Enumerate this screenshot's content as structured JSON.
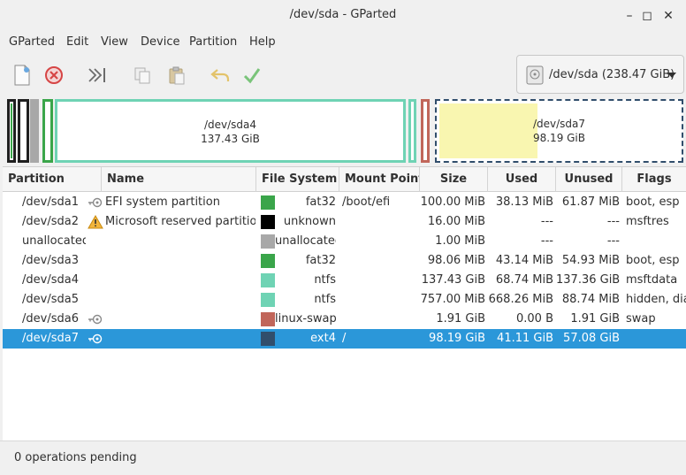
{
  "window": {
    "title": "/dev/sda - GParted"
  },
  "window_controls": {
    "minimize": "–",
    "maximize": "◻",
    "close": "✕"
  },
  "menu": [
    "GParted",
    "Edit",
    "View",
    "Device",
    "Partition",
    "Help"
  ],
  "toolbar": {
    "icons": [
      "new-icon",
      "delete-icon",
      "resize-move-icon",
      "copy-icon",
      "paste-icon",
      "undo-icon",
      "apply-icon"
    ]
  },
  "device_selector": {
    "label": "/dev/sda  (238.47 GiB)",
    "icon": "disk-icon"
  },
  "disk_map": {
    "segments": [
      {
        "name": "/dev/sda4",
        "size": "137.43 GiB",
        "color": "#6fd3b4"
      },
      {
        "name": "/dev/sda7",
        "size": "98.19 GiB",
        "color": "#f9f6b0",
        "selected": true
      }
    ]
  },
  "table": {
    "headers": [
      "Partition",
      "Name",
      "File System",
      "Mount Point",
      "Size",
      "Used",
      "Unused",
      "Flags"
    ],
    "rows": [
      {
        "partition": "/dev/sda1",
        "icon": "key-icon",
        "name": "EFI system partition",
        "fs": "fat32",
        "fs_color": "#3aa54a",
        "mount": "/boot/efi",
        "size": "100.00 MiB",
        "used": "38.13 MiB",
        "unused": "61.87 MiB",
        "flags": "boot, esp"
      },
      {
        "partition": "/dev/sda2",
        "icon": "warning-icon",
        "name": "Microsoft reserved partition",
        "fs": "unknown",
        "fs_color": "#000000",
        "mount": "",
        "size": "16.00 MiB",
        "used": "---",
        "unused": "---",
        "flags": "msftres"
      },
      {
        "partition": "unallocated",
        "icon": "",
        "name": "",
        "fs": "unallocated",
        "fs_color": "#a8a8a8",
        "mount": "",
        "size": "1.00 MiB",
        "used": "---",
        "unused": "---",
        "flags": ""
      },
      {
        "partition": "/dev/sda3",
        "icon": "",
        "name": "",
        "fs": "fat32",
        "fs_color": "#3aa54a",
        "mount": "",
        "size": "98.06 MiB",
        "used": "43.14 MiB",
        "unused": "54.93 MiB",
        "flags": "boot, esp"
      },
      {
        "partition": "/dev/sda4",
        "icon": "",
        "name": "",
        "fs": "ntfs",
        "fs_color": "#6fd3b4",
        "mount": "",
        "size": "137.43 GiB",
        "used": "68.74 MiB",
        "unused": "137.36 GiB",
        "flags": "msftdata"
      },
      {
        "partition": "/dev/sda5",
        "icon": "",
        "name": "",
        "fs": "ntfs",
        "fs_color": "#6fd3b4",
        "mount": "",
        "size": "757.00 MiB",
        "used": "668.26 MiB",
        "unused": "88.74 MiB",
        "flags": "hidden, diag"
      },
      {
        "partition": "/dev/sda6",
        "icon": "key-icon",
        "name": "",
        "fs": "linux-swap",
        "fs_color": "#c1665a",
        "mount": "",
        "size": "1.91 GiB",
        "used": "0.00 B",
        "unused": "1.91 GiB",
        "flags": "swap"
      },
      {
        "partition": "/dev/sda7",
        "icon": "key-icon",
        "name": "",
        "fs": "ext4",
        "fs_color": "#314e6c",
        "mount": "/",
        "size": "98.19 GiB",
        "used": "41.11 GiB",
        "unused": "57.08 GiB",
        "flags": "",
        "selected": true
      }
    ]
  },
  "status": {
    "text": "0 operations pending"
  }
}
